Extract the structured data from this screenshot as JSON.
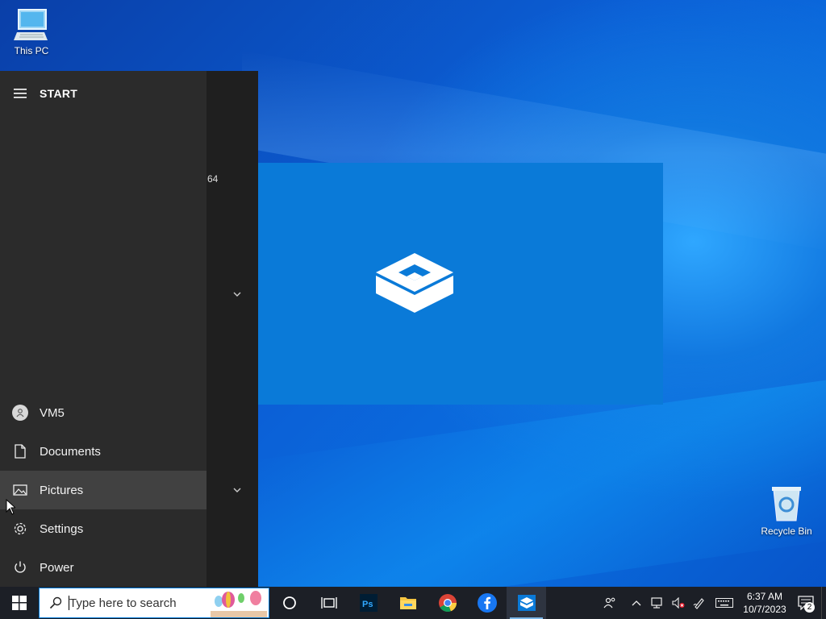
{
  "desktop": {
    "icons": [
      {
        "label": "This PC"
      },
      {
        "label": "Recycle Bin"
      }
    ]
  },
  "start_menu": {
    "title": "START",
    "tile_number": "64",
    "items": [
      {
        "label": "VM5",
        "icon": "user-avatar-icon"
      },
      {
        "label": "Documents",
        "icon": "document-icon"
      },
      {
        "label": "Pictures",
        "icon": "picture-icon"
      },
      {
        "label": "Settings",
        "icon": "gear-icon"
      },
      {
        "label": "Power",
        "icon": "power-icon"
      }
    ]
  },
  "taskbar": {
    "search_placeholder": "Type here to search",
    "apps": [
      "cortana-icon",
      "task-view-icon",
      "photoshop-icon",
      "file-explorer-icon",
      "chrome-icon",
      "facebook-icon",
      "sandbox-icon"
    ],
    "tray": {
      "time": "6:37 AM",
      "date": "10/7/2023",
      "notification_count": "2"
    }
  },
  "colors": {
    "accent": "#0078d7",
    "start_bg": "#2b2b2b",
    "taskbar_bg": "#1c1f26",
    "splash_bg": "#0a7ad8"
  }
}
